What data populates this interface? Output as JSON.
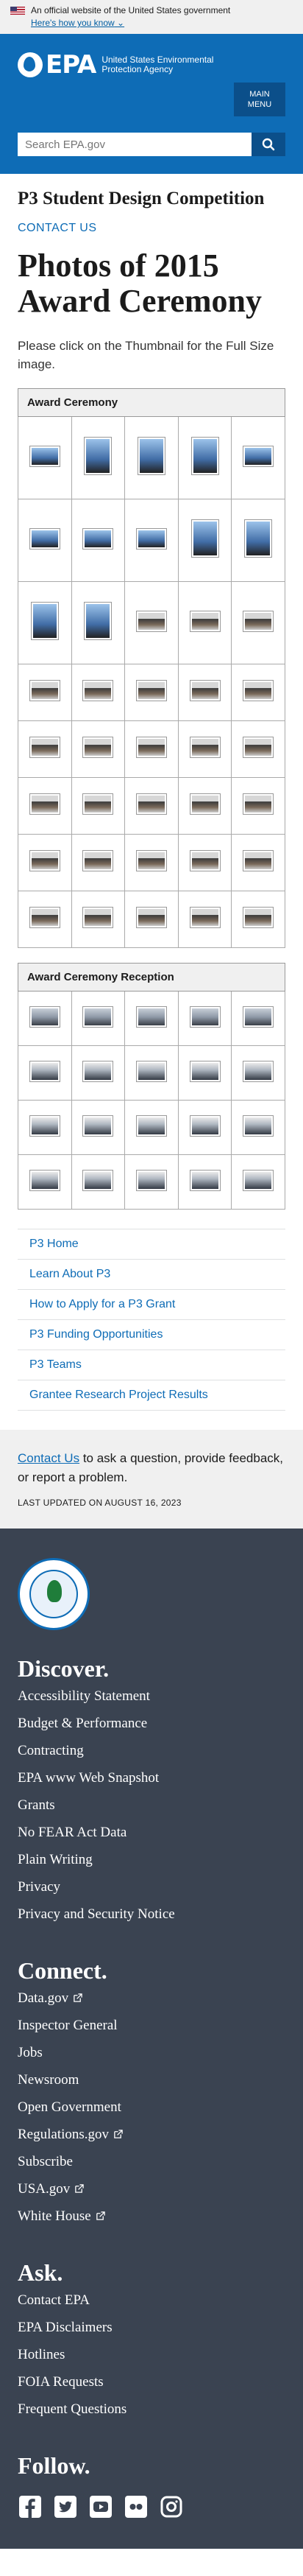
{
  "gov_banner": {
    "text": "An official website of the United States government",
    "link": "Here's how you know"
  },
  "header": {
    "logo": "EPA",
    "agency": "United States Environmental Protection Agency",
    "menu_label_1": "MAIN",
    "menu_label_2": "MENU",
    "search_placeholder": "Search EPA.gov"
  },
  "main": {
    "section_title": "P3 Student Design Competition",
    "contact_us": "CONTACT US",
    "title": "Photos of 2015 Award Ceremony",
    "intro": "Please click on the Thumbnail for the Full Size image.",
    "gallery1_header": "Award Ceremony",
    "gallery2_header": "Award Ceremony Reception"
  },
  "subnav": [
    "P3 Home",
    "Learn About P3",
    "How to Apply for a P3 Grant",
    "P3 Funding Opportunities",
    "P3 Teams",
    "Grantee Research Project Results"
  ],
  "contact_footer": {
    "link": "Contact Us",
    "text": " to ask a question, provide feedback, or report a problem.",
    "updated": "LAST UPDATED ON AUGUST 16, 2023"
  },
  "footer": {
    "discover_title": "Discover.",
    "discover": [
      "Accessibility Statement",
      "Budget & Performance",
      "Contracting",
      "EPA www Web Snapshot",
      "Grants",
      "No FEAR Act Data",
      "Plain Writing",
      "Privacy",
      "Privacy and Security Notice"
    ],
    "connect_title": "Connect.",
    "connect": [
      "Data.gov",
      "Inspector General",
      "Jobs",
      "Newsroom",
      "Open Government",
      "Regulations.gov",
      "Subscribe",
      "USA.gov",
      "White House"
    ],
    "ask_title": "Ask.",
    "ask": [
      "Contact EPA",
      "EPA Disclaimers",
      "Hotlines",
      "FOIA Requests",
      "Frequent Questions"
    ],
    "follow_title": "Follow.",
    "social_icons": [
      "facebook-icon",
      "twitter-icon",
      "youtube-icon",
      "flickr-icon",
      "instagram-icon"
    ]
  },
  "colors": {
    "brand_blue": "#0e6cb6",
    "dark_blue": "#0b4f8a",
    "footer_bg": "#3a4351"
  }
}
